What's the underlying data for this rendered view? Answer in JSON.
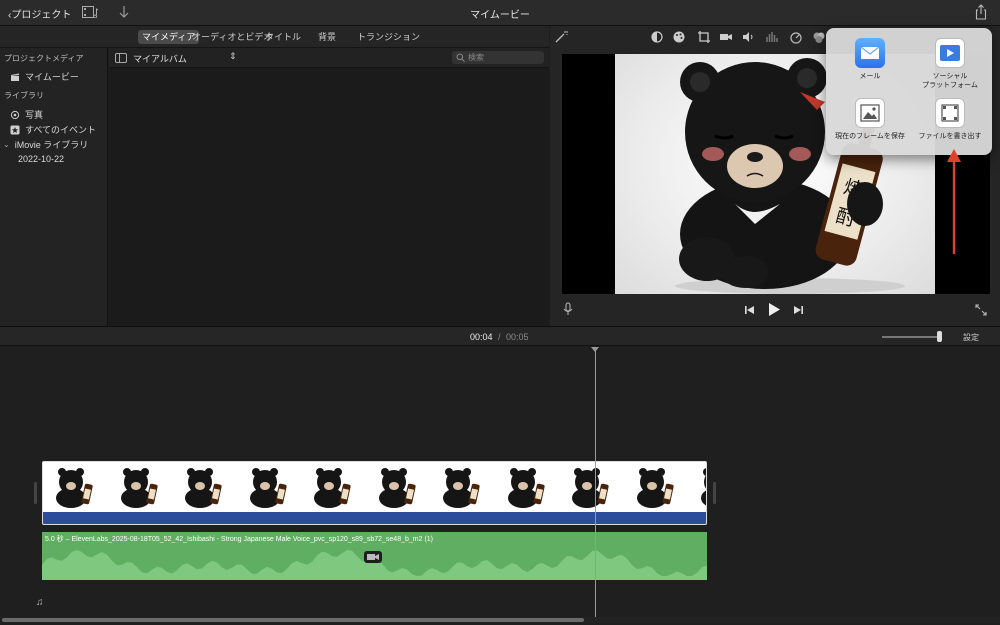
{
  "toolbar": {
    "back_label": "プロジェクト",
    "title": "マイムービー"
  },
  "browser": {
    "tabs": [
      {
        "label": "マイメディア",
        "active": true
      },
      {
        "label": "オーディオとビデオ",
        "active": false
      },
      {
        "label": "タイトル",
        "active": false
      },
      {
        "label": "背景",
        "active": false
      },
      {
        "label": "トランジション",
        "active": false
      }
    ],
    "album_label": "マイアルバム",
    "search_placeholder": "検索"
  },
  "sidebar": {
    "project_media_heading": "プロジェクトメディア",
    "project_item": "マイムービー",
    "library_heading": "ライブラリ",
    "items": [
      {
        "label": "写真",
        "icon": "photos-icon"
      },
      {
        "label": "すべてのイベント",
        "icon": "star-icon"
      }
    ],
    "library_name": "iMovie ライブラリ",
    "event_date": "2022-10-22"
  },
  "viewer": {
    "sign_text": "焼酎"
  },
  "share_popover": {
    "items": [
      {
        "label": "メール",
        "icon": "mail-icon"
      },
      {
        "label": "ソーシャル\nプラットフォーム",
        "icon": "social-platform-icon"
      },
      {
        "label": "現在のフレームを保存",
        "icon": "save-frame-icon"
      },
      {
        "label": "ファイルを書き出す",
        "icon": "export-file-icon"
      }
    ]
  },
  "timeline": {
    "current_time": "00:04",
    "separator": "/",
    "total_time": "00:05",
    "settings_label": "設定",
    "audio_clip_label": "5.0 秒 – ElevenLabs_2025-08-18T05_52_42_Ishibashi - Strong Japanese Male Voice_pvc_sp120_s89_sb72_se48_b_m2 (1)"
  },
  "colors": {
    "accent_arrow": "#e0412a",
    "video_strip": "#2d4d9a",
    "audio_clip": "#5fae61"
  }
}
